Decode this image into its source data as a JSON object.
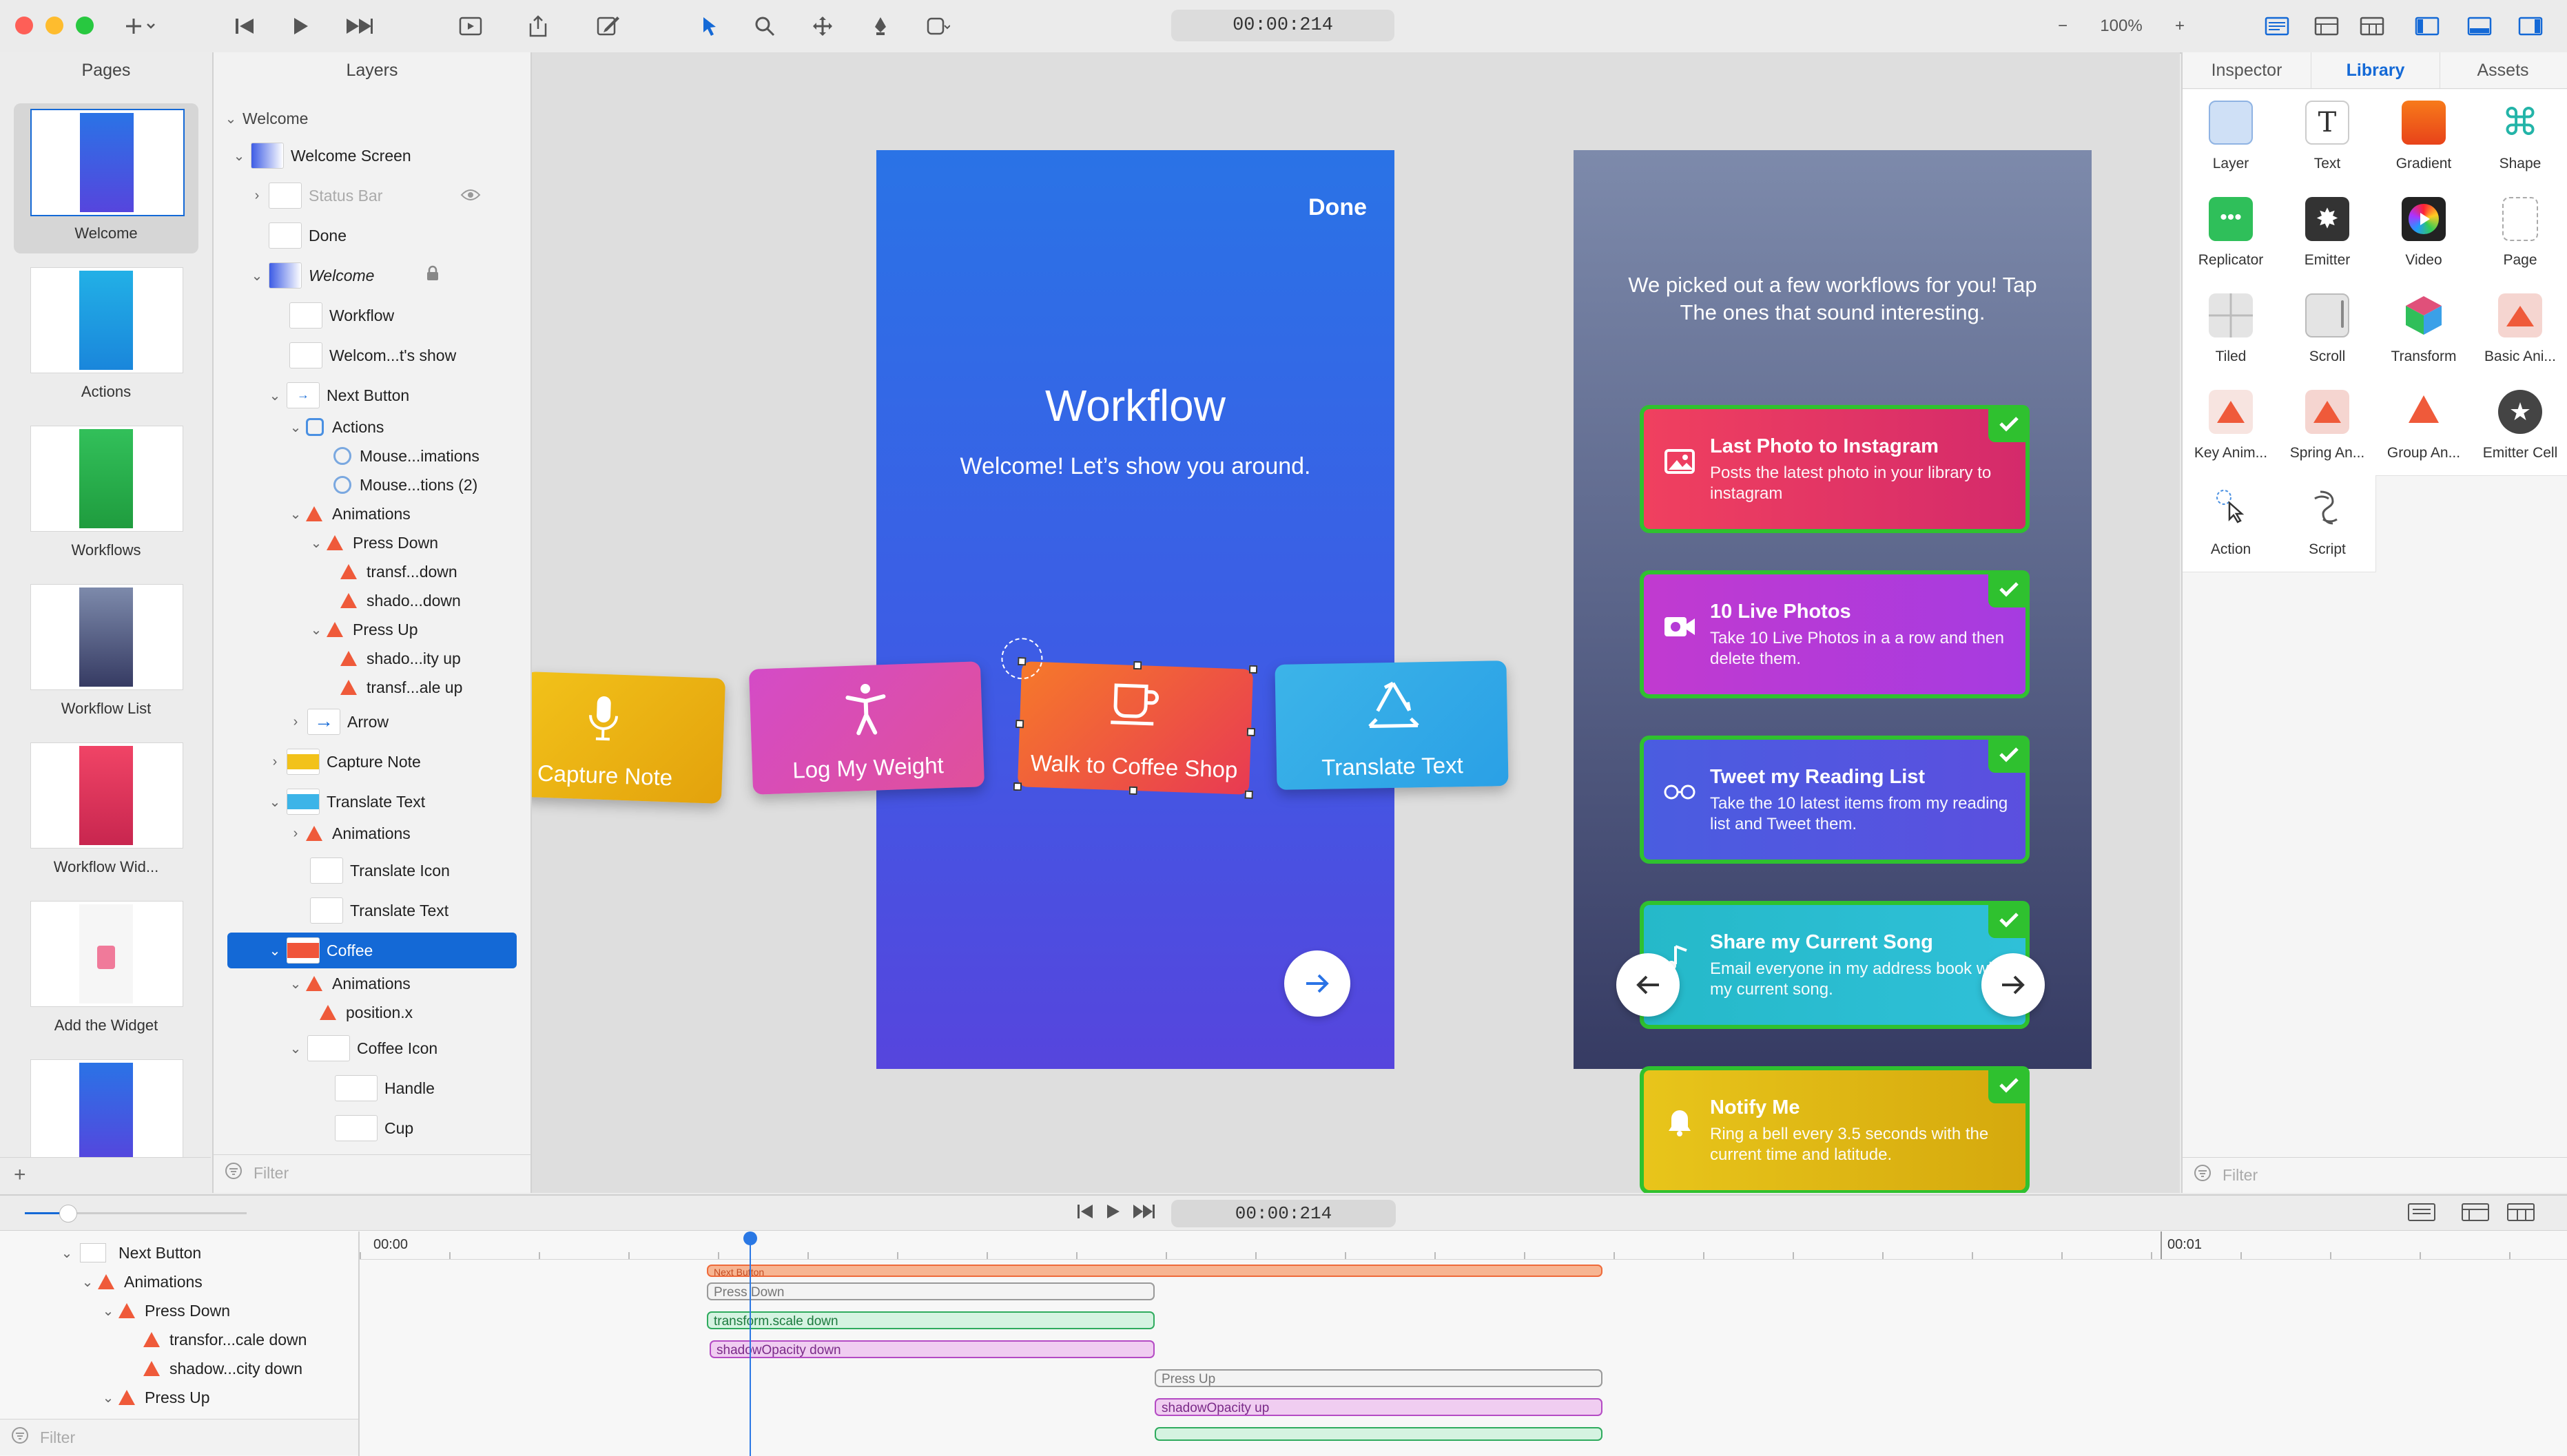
{
  "toolbar": {
    "timecode": "00:00:214",
    "zoom": "100%",
    "zoom_minus": "−",
    "zoom_plus": "+"
  },
  "pages_panel": {
    "title": "Pages",
    "pages": [
      {
        "label": "Welcome",
        "color": "#3f5fe4"
      },
      {
        "label": "Actions",
        "color": "#1f9be0"
      },
      {
        "label": "Workflows",
        "color": "#28b34a"
      },
      {
        "label": "Workflow List",
        "color": "#5d6794"
      },
      {
        "label": "Workflow Wid...",
        "color": "#e2345b"
      },
      {
        "label": "Add the Widget",
        "color": "#f0f0f0"
      },
      {
        "label": "",
        "color": "#3a5fe2"
      }
    ],
    "add": "+"
  },
  "layers_panel": {
    "title": "Layers",
    "root": "Welcome",
    "rows": [
      {
        "label": "Welcome Screen"
      },
      {
        "label": "Status Bar"
      },
      {
        "label": "Done"
      },
      {
        "label": "Welcome"
      },
      {
        "label": "Workflow"
      },
      {
        "label": "Welcom...t's show"
      },
      {
        "label": "Next Button"
      },
      {
        "label": "Actions"
      },
      {
        "label": "Mouse...imations"
      },
      {
        "label": "Mouse...tions (2)"
      },
      {
        "label": "Animations"
      },
      {
        "label": "Press Down"
      },
      {
        "label": "transf...down"
      },
      {
        "label": "shado...down"
      },
      {
        "label": "Press Up"
      },
      {
        "label": "shado...ity up"
      },
      {
        "label": "transf...ale up"
      },
      {
        "label": "Arrow"
      },
      {
        "label": "Capture Note"
      },
      {
        "label": "Translate Text"
      },
      {
        "label": "Animations"
      },
      {
        "label": "Translate Icon"
      },
      {
        "label": "Translate Text"
      },
      {
        "label": "Coffee"
      },
      {
        "label": "Animations"
      },
      {
        "label": "position.x"
      },
      {
        "label": "Coffee Icon"
      },
      {
        "label": "Handle"
      },
      {
        "label": "Cup"
      }
    ],
    "filter_placeholder": "Filter"
  },
  "canvas": {
    "welcome_screen": {
      "done": "Done",
      "title": "Workflow",
      "subtitle": "Welcome! Let’s show you around."
    },
    "action_cards": [
      {
        "label": "Capture Note",
        "icon": "mic-icon",
        "color_a": "#f2c21a",
        "color_b": "#e3a20c"
      },
      {
        "label": "Log My Weight",
        "icon": "person-icon",
        "color_a": "#d44bc7",
        "color_b": "#e0509a"
      },
      {
        "label": "Walk to Coffee Shop",
        "icon": "coffee-icon",
        "color_a": "#f6792a",
        "color_b": "#e83a53"
      },
      {
        "label": "Translate Text",
        "icon": "recycle-icon",
        "color_a": "#3cb4e8",
        "color_b": "#2aa0e6"
      }
    ],
    "workflow_list": {
      "intro": "We picked out a few workflows for you! Tap The ones that sound interesting.",
      "items": [
        {
          "title": "Last Photo to Instagram",
          "desc": "Posts the latest photo in your library to instagram",
          "icon": "photo-icon",
          "color_a": "#f0405f",
          "color_b": "#d42a6b"
        },
        {
          "title": "10 Live Photos",
          "desc": "Take 10 Live Photos in a a row and then delete them.",
          "icon": "video-icon",
          "color_a": "#c13ad0",
          "color_b": "#a63be0"
        },
        {
          "title": "Tweet my Reading List",
          "desc": "Take the 10 latest items from my reading list and Tweet them.",
          "icon": "glasses-icon",
          "color_a": "#4a5de0",
          "color_b": "#5b4fdf"
        },
        {
          "title": "Share my Current Song",
          "desc": "Email everyone in my address book with my current song.",
          "icon": "music-icon",
          "color_a": "#25b9c9",
          "color_b": "#2fc0d8"
        },
        {
          "title": "Notify Me",
          "desc": "Ring a bell every 3.5 seconds with the current time and latitude.",
          "icon": "bell-icon",
          "color_a": "#e8c51b",
          "color_b": "#d5a90d"
        }
      ]
    }
  },
  "right_panel": {
    "tabs": [
      "Inspector",
      "Library",
      "Assets"
    ],
    "library": [
      {
        "label": "Layer",
        "icon": "layer-icon"
      },
      {
        "label": "Text",
        "icon": "text-icon"
      },
      {
        "label": "Gradient",
        "icon": "gradient-icon"
      },
      {
        "label": "Shape",
        "icon": "shape-icon"
      },
      {
        "label": "Replicator",
        "icon": "replicator-icon"
      },
      {
        "label": "Emitter",
        "icon": "emitter-icon"
      },
      {
        "label": "Video",
        "icon": "video-icon"
      },
      {
        "label": "Page",
        "icon": "page-icon"
      },
      {
        "label": "Tiled",
        "icon": "tiled-icon"
      },
      {
        "label": "Scroll",
        "icon": "scroll-icon"
      },
      {
        "label": "Transform",
        "icon": "transform-icon"
      },
      {
        "label": "Basic Ani...",
        "icon": "basic-animation-icon"
      },
      {
        "label": "Key Anim...",
        "icon": "key-animation-icon"
      },
      {
        "label": "Spring An...",
        "icon": "spring-animation-icon"
      },
      {
        "label": "Group An...",
        "icon": "group-animation-icon"
      },
      {
        "label": "Emitter Cell",
        "icon": "emitter-cell-icon"
      },
      {
        "label": "Action",
        "icon": "action-icon"
      },
      {
        "label": "Script",
        "icon": "script-icon"
      }
    ],
    "filter_placeholder": "Filter"
  },
  "timeline": {
    "timecode": "00:00:214",
    "ruler_start": "00:00",
    "ruler_end": "00:01",
    "tree": [
      {
        "label": "Next Button"
      },
      {
        "label": "Animations"
      },
      {
        "label": "Press Down"
      },
      {
        "label": "transfor...cale down"
      },
      {
        "label": "shadow...city down"
      },
      {
        "label": "Press Up"
      }
    ],
    "bars": [
      {
        "label": "Next Button"
      },
      {
        "label": "Press Down"
      },
      {
        "label": "transform.scale down"
      },
      {
        "label": "shadowOpacity down"
      },
      {
        "label": "Press Up"
      },
      {
        "label": "shadowOpacity up"
      }
    ],
    "filter_placeholder": "Filter"
  }
}
